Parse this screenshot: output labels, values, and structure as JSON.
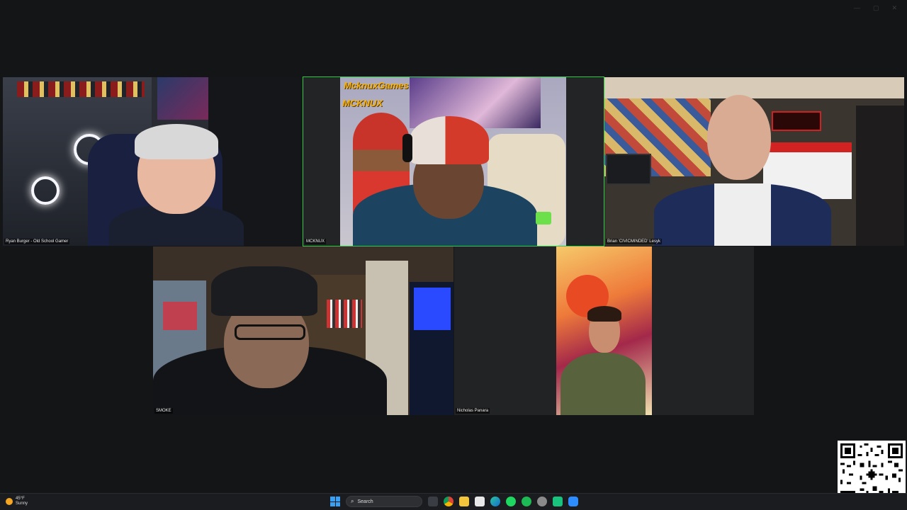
{
  "window": {
    "controls": [
      "—",
      "▢",
      "✕"
    ]
  },
  "participants": [
    {
      "name": "Ryan Burger - Old School Gamer"
    },
    {
      "name": "MCKNUX",
      "overlay_line1": "McknuxGames",
      "overlay_line2": "MCKNUX"
    },
    {
      "name": "Brian 'CIVICMINDED' Lesyk"
    },
    {
      "name": "SMOKE"
    },
    {
      "name": "Nicholas Panara"
    }
  ],
  "taskbar": {
    "weather_temp": "45°F",
    "weather_cond": "Sunny",
    "search_label": "Search",
    "icons": [
      "task-view-icon",
      "chrome-icon",
      "file-explorer-icon",
      "store-icon",
      "edge-icon",
      "spotify-icon",
      "spotify-alt-icon",
      "settings-icon",
      "app-icon",
      "zoom-icon"
    ]
  },
  "colors": {
    "active_speaker": "#2ecc40",
    "background": "#131517",
    "overlay_text": "#f5b316"
  }
}
